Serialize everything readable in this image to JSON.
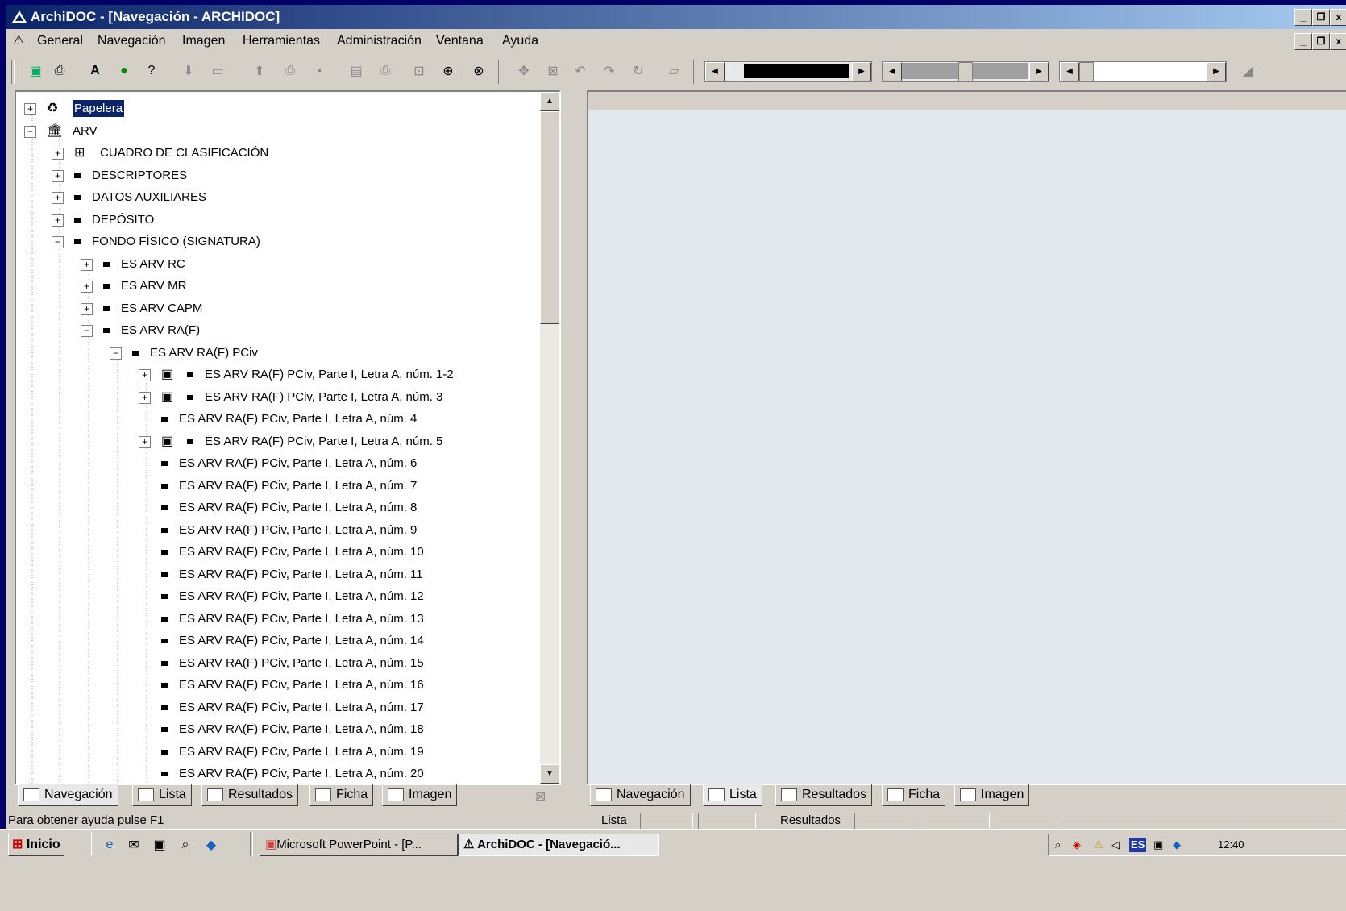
{
  "window": {
    "title": "ArchiDOC - [Navegación - ARCHIDOC]"
  },
  "menu": [
    "General",
    "Navegación",
    "Imagen",
    "Herramientas",
    "Administración",
    "Ventana",
    "Ayuda"
  ],
  "tree": {
    "rows": [
      {
        "label": "Papelera",
        "selected": true
      },
      {
        "label": "ARV"
      },
      {
        "label": "CUADRO DE CLASIFICACIÓN"
      },
      {
        "label": "DESCRIPTORES"
      },
      {
        "label": "DATOS AUXILIARES"
      },
      {
        "label": "DEPÓSITO"
      },
      {
        "label": "FONDO FÍSICO (SIGNATURA)"
      },
      {
        "label": "ES ARV RC"
      },
      {
        "label": "ES ARV MR"
      },
      {
        "label": "ES ARV CAPM"
      },
      {
        "label": "ES ARV RA(F)"
      },
      {
        "label": "ES ARV RA(F) PCiv"
      },
      {
        "label": "ES ARV RA(F) PCiv, Parte I, Letra A, núm. 1-2"
      },
      {
        "label": "ES ARV RA(F) PCiv, Parte I, Letra A, núm. 3"
      },
      {
        "label": "ES ARV RA(F) PCiv, Parte I, Letra A, núm. 4"
      },
      {
        "label": "ES ARV RA(F) PCiv, Parte I, Letra A, núm. 5"
      },
      {
        "label": "ES ARV RA(F) PCiv, Parte I, Letra A, núm. 6"
      },
      {
        "label": "ES ARV RA(F) PCiv, Parte I, Letra A, núm. 7"
      },
      {
        "label": "ES ARV RA(F) PCiv, Parte I, Letra A, núm. 8"
      },
      {
        "label": "ES ARV RA(F) PCiv, Parte I, Letra A, núm. 9"
      },
      {
        "label": "ES ARV RA(F) PCiv, Parte I, Letra A, núm. 10"
      },
      {
        "label": "ES ARV RA(F) PCiv, Parte I, Letra A, núm. 11"
      },
      {
        "label": "ES ARV RA(F) PCiv, Parte I, Letra A, núm. 12"
      },
      {
        "label": "ES ARV RA(F) PCiv, Parte I, Letra A, núm. 13"
      },
      {
        "label": "ES ARV RA(F) PCiv, Parte I, Letra A, núm. 14"
      },
      {
        "label": "ES ARV RA(F) PCiv, Parte I, Letra A, núm. 15"
      },
      {
        "label": "ES ARV RA(F) PCiv, Parte I, Letra A, núm. 16"
      },
      {
        "label": "ES ARV RA(F) PCiv, Parte I, Letra A, núm. 17"
      },
      {
        "label": "ES ARV RA(F) PCiv, Parte I, Letra A, núm. 18"
      },
      {
        "label": "ES ARV RA(F) PCiv, Parte I, Letra A, núm. 19"
      },
      {
        "label": "ES ARV RA(F) PCiv, Parte I, Letra A, núm. 20"
      }
    ]
  },
  "left_tabs": [
    "Navegación",
    "Lista",
    "Resultados",
    "Ficha",
    "Imagen"
  ],
  "right_tabs": [
    "Navegación",
    "Lista",
    "Resultados",
    "Ficha",
    "Imagen"
  ],
  "status": {
    "help": "Para obtener ayuda pulse F1",
    "lista": "Lista",
    "resultados": "Resultados"
  },
  "taskbar": {
    "start": "Inicio",
    "tasks": [
      "Microsoft PowerPoint - [P...",
      "ArchiDOC - [Navegació..."
    ],
    "tray_lang": "ES",
    "clock": "12:40"
  },
  "colors": {
    "desktop": "#000066",
    "title_start": "#0a246a",
    "selection": "#0a246a",
    "right_pane": "#e1e9ee"
  }
}
